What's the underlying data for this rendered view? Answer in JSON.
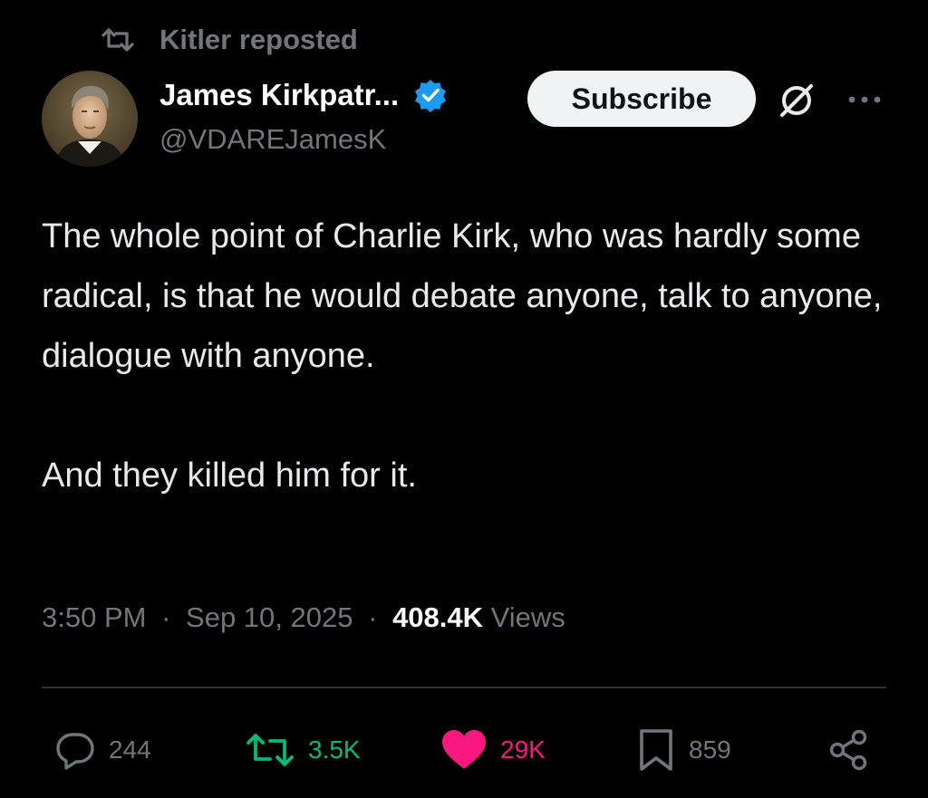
{
  "repost": {
    "icon": "repost-icon",
    "text": "Kitler reposted"
  },
  "author": {
    "display_name": "James Kirkpatr...",
    "handle": "@VDAREJamesK",
    "verified_icon": "verified-badge-icon",
    "verified_color": "#1d9bf0",
    "avatar": "portrait-avatar"
  },
  "header_actions": {
    "subscribe_label": "Subscribe",
    "grok_icon": "grok-icon",
    "more_icon": "more-dots-icon"
  },
  "tweet": {
    "paragraph_1": "The whole point of Charlie Kirk, who was hardly some radical, is that he would debate anyone, talk to anyone, dialogue with anyone.",
    "paragraph_2": "And they killed him for it."
  },
  "meta": {
    "time": "3:50 PM",
    "separator": "·",
    "date": "Sep 10, 2025",
    "views_count": "408.4K",
    "views_label": "Views"
  },
  "engagement": {
    "replies": {
      "icon": "reply-icon",
      "count": "244",
      "color": "#71767b"
    },
    "reposts": {
      "icon": "repost-icon",
      "count": "3.5K",
      "color": "#00ba7c"
    },
    "likes": {
      "icon": "heart-icon",
      "count": "29K",
      "color": "#f91880"
    },
    "bookmarks": {
      "icon": "bookmark-icon",
      "count": "859",
      "color": "#71767b"
    },
    "share": {
      "icon": "share-icon",
      "color": "#71767b"
    }
  }
}
